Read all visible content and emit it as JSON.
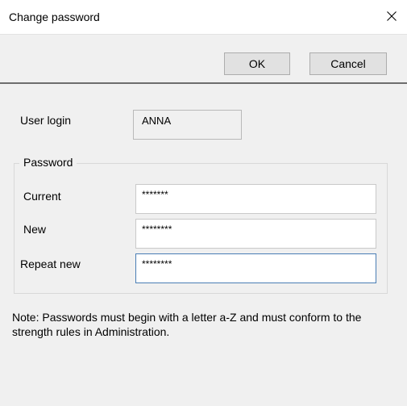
{
  "window": {
    "title": "Change password"
  },
  "toolbar": {
    "ok_label": "OK",
    "cancel_label": "Cancel"
  },
  "user": {
    "label": "User login",
    "value": "ANNA"
  },
  "password_group": {
    "legend": "Password",
    "fields": [
      {
        "label": "Current",
        "value": "*******"
      },
      {
        "label": "New",
        "value": "********"
      },
      {
        "label": "Repeat new",
        "value": "********"
      }
    ]
  },
  "note": "Note: Passwords must begin with a letter a-Z and must conform to the strength rules in Administration.",
  "icons": {
    "close": "close-icon"
  },
  "colors": {
    "focus_border": "#4a7eb5",
    "toolbar_divider": "#6d6d6d"
  }
}
